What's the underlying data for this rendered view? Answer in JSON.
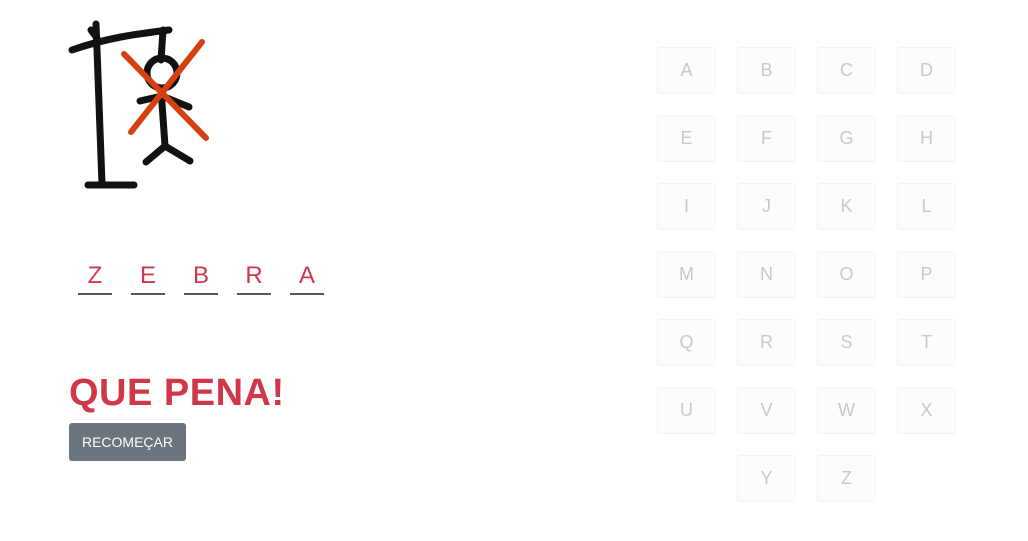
{
  "game": {
    "word_letters": [
      "Z",
      "E",
      "B",
      "R",
      "A"
    ],
    "result_message": "QUE PENA!",
    "restart_label": "RECOMEÇAR"
  },
  "keyboard": {
    "letters": [
      "A",
      "B",
      "C",
      "D",
      "E",
      "F",
      "G",
      "H",
      "I",
      "J",
      "K",
      "L",
      "M",
      "N",
      "O",
      "P",
      "Q",
      "R",
      "S",
      "T",
      "U",
      "V",
      "W",
      "X",
      "Y",
      "Z"
    ],
    "disabled": true
  },
  "colors": {
    "word_color": "#d0384a",
    "result_color": "#d0384a",
    "button_bg": "#6c757d",
    "key_text": "#c9c9c9",
    "cross_color": "#d4400f"
  },
  "icons": {
    "hangman": "hangman-gallows-icon",
    "cross": "lost-cross-icon"
  }
}
